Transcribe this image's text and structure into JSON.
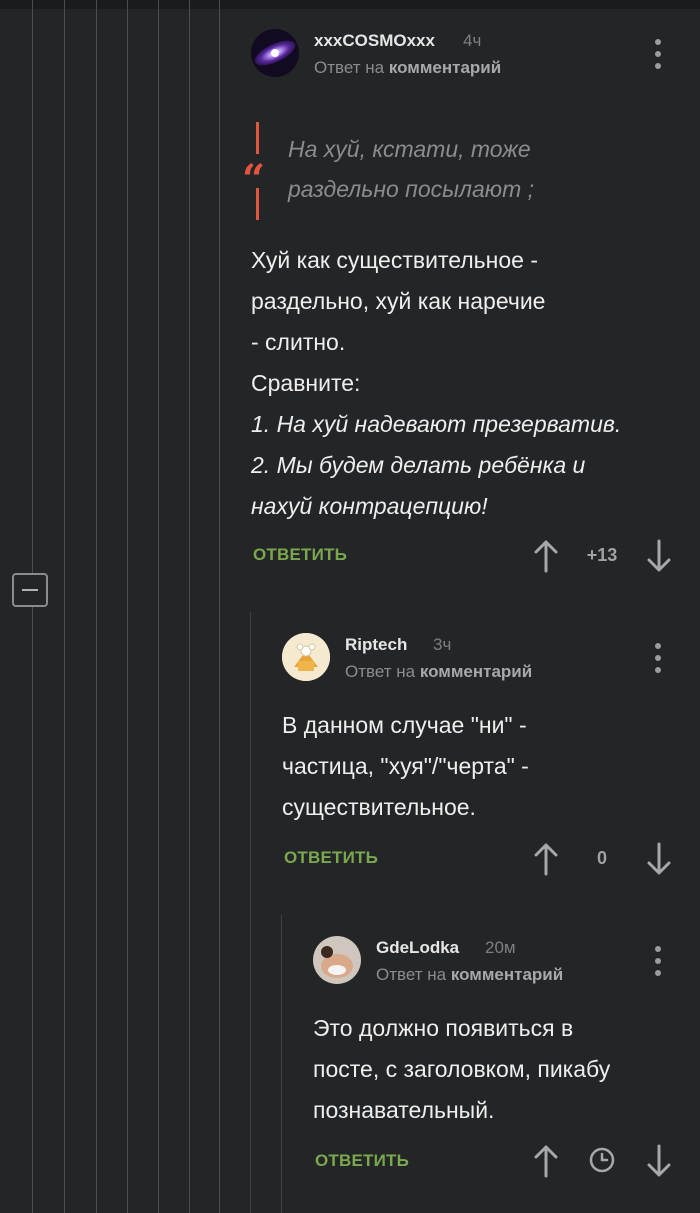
{
  "comments": [
    {
      "author": "xxxCOSMOxxx",
      "time": "4ч",
      "reply_prefix": "Ответ на",
      "reply_link": "комментарий",
      "quote_lines": [
        "На хуй, кстати, тоже",
        "раздельно посылают ;"
      ],
      "body_lines": [
        "Хуй как существительное -",
        "раздельно, хуй как наречие",
        "- слитно.",
        "Сравните:"
      ],
      "body_italic_lines": [
        "1. На хуй надевают презерватив.",
        "2. Мы будем делать ребёнка и",
        "нахуй контрацепцию!"
      ],
      "reply_label": "ОТВЕТИТЬ",
      "score": "+13"
    },
    {
      "author": "Riptech",
      "time": "3ч",
      "reply_prefix": "Ответ на",
      "reply_link": "комментарий",
      "body_lines": [
        "В данном случае \"ни\" -",
        "частица, \"хуя\"/\"черта\" -",
        "существительное."
      ],
      "reply_label": "ОТВЕТИТЬ",
      "score": "0"
    },
    {
      "author": "GdeLodka",
      "time": "20м",
      "reply_prefix": "Ответ на",
      "reply_link": "комментарий",
      "body_lines": [
        "Это должно появиться в",
        "посте, с заголовком, пикабу",
        "познавательный."
      ],
      "reply_label": "ОТВЕТИТЬ"
    }
  ],
  "colors": {
    "background": "#232527",
    "reply_green": "#7aa84e",
    "quote_accent": "#e2553f",
    "thread_line": "#4a4c4f"
  },
  "icons": {
    "upvote": "arrow-up-icon",
    "downvote": "arrow-down-icon",
    "menu": "more-vertical-icon",
    "pending": "clock-icon",
    "collapse": "minus-icon"
  }
}
